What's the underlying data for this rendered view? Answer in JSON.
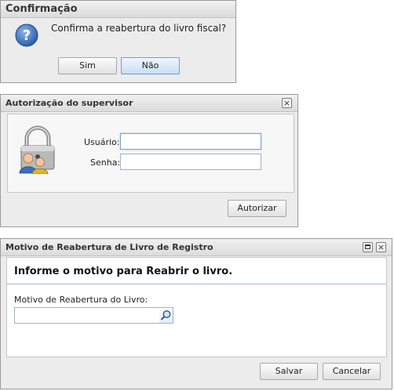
{
  "confirm": {
    "title": "Confirmação",
    "message": "Confirma a reabertura do livro fiscal?",
    "yes_label": "Sim",
    "no_label": "Não"
  },
  "auth": {
    "title": "Autorização do supervisor",
    "user_label": "Usuário:",
    "user_value": "",
    "password_label": "Senha:",
    "password_value": "",
    "authorize_label": "Autorizar",
    "icons": [
      "question-icon",
      "lock-users-icon",
      "close-icon"
    ]
  },
  "reason": {
    "title": "Motivo de Reabertura de Livro de Registro",
    "heading": "Informe o motivo para Reabrir o livro.",
    "field_label": "Motivo de Reabertura do Livro:",
    "field_value": "",
    "save_label": "Salvar",
    "cancel_label": "Cancelar",
    "icons": [
      "maximize-icon",
      "close-icon",
      "search-icon"
    ]
  },
  "colors": {
    "titlebar": "#dcdcdc",
    "dialog_bg": "#ececec",
    "accent": "#3d6fb5"
  }
}
